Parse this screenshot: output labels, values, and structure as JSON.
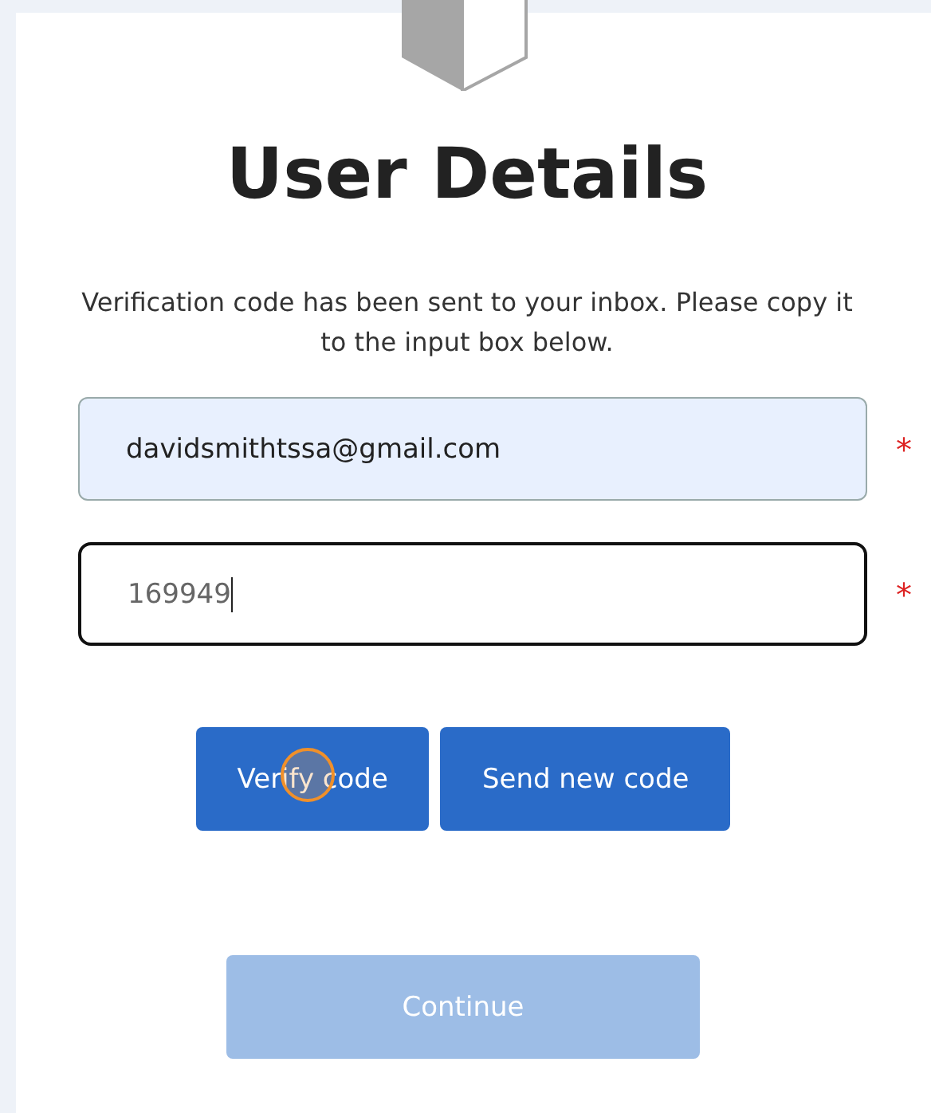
{
  "title": "User Details",
  "message": "Verification code has been sent to your inbox. Please copy it to the input box below.",
  "fields": [
    {
      "kind": "autofilled",
      "value": "davidsmithtssa@gmail.com",
      "required": "*",
      "focused": false
    },
    {
      "kind": "plain",
      "value": "169949",
      "required": "*",
      "focused": true
    }
  ],
  "buttons": [
    {
      "label": "Verify code",
      "clicked": true
    },
    {
      "label": "Send new code",
      "clicked": false
    }
  ],
  "continue_button": {
    "label": "Continue",
    "disabled": true
  }
}
